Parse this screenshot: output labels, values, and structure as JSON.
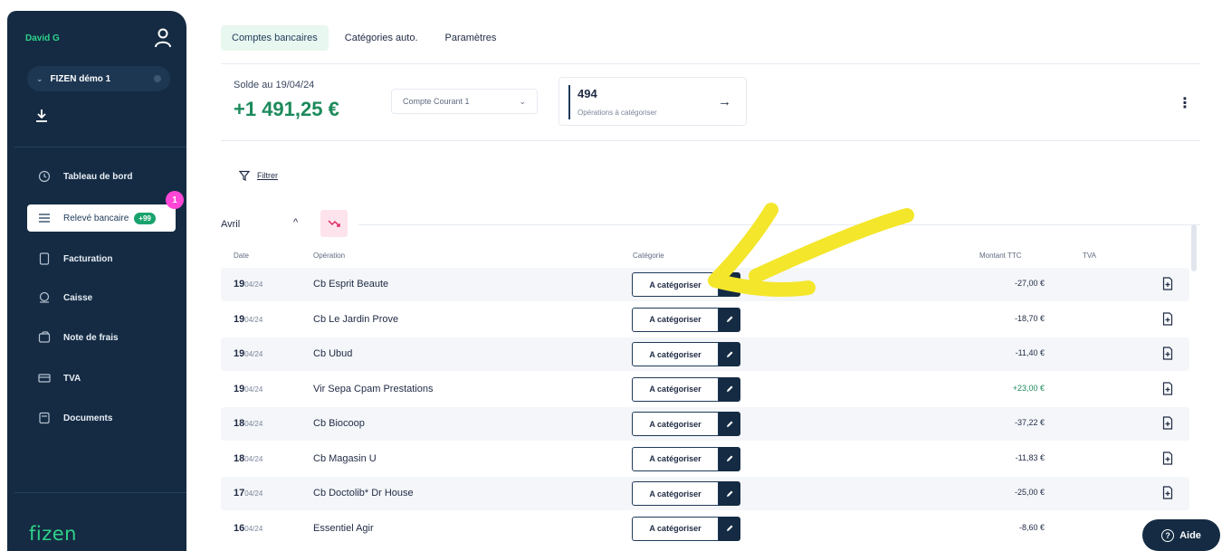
{
  "sidebar": {
    "user_name": "David G",
    "company": "FIZEN démo 1",
    "notification_count": "1",
    "items": [
      {
        "label": "Tableau de bord",
        "icon": "clock-icon"
      },
      {
        "label": "Relevé bancaire",
        "icon": "list-icon",
        "badge": "+99",
        "active": true
      },
      {
        "label": "Facturation",
        "icon": "document-icon"
      },
      {
        "label": "Caisse",
        "icon": "cash-icon"
      },
      {
        "label": "Note de frais",
        "icon": "wallet-icon"
      },
      {
        "label": "TVA",
        "icon": "card-icon"
      },
      {
        "label": "Documents",
        "icon": "folder-icon"
      }
    ],
    "logo": "fizen"
  },
  "header": {
    "tabs": [
      {
        "label": "Comptes bancaires",
        "active": true
      },
      {
        "label": "Catégories auto."
      },
      {
        "label": "Paramètres"
      }
    ]
  },
  "summary": {
    "solde_label": "Solde au 19/04/24",
    "solde_value": "+1 491,25 €",
    "account": "Compte Courant 1",
    "ops_count": "494",
    "ops_label": "Opérations à catégoriser"
  },
  "filter": {
    "label": "Filtrer"
  },
  "month": {
    "label": "Avril"
  },
  "table": {
    "headers": {
      "date": "Date",
      "operation": "Opération",
      "category": "Catégorie",
      "amount": "Montant TTC",
      "tva": "TVA"
    },
    "rows": [
      {
        "day": "19",
        "month": "04/24",
        "operation": "Cb Esprit Beaute",
        "category": "A catégoriser",
        "amount": "-27,00 €",
        "positive": false
      },
      {
        "day": "19",
        "month": "04/24",
        "operation": "Cb Le Jardin Prove",
        "category": "A catégoriser",
        "amount": "-18,70 €",
        "positive": false
      },
      {
        "day": "19",
        "month": "04/24",
        "operation": "Cb Ubud",
        "category": "A catégoriser",
        "amount": "-11,40 €",
        "positive": false
      },
      {
        "day": "19",
        "month": "04/24",
        "operation": "Vir Sepa Cpam Prestations",
        "category": "A catégoriser",
        "amount": "+23,00 €",
        "positive": true
      },
      {
        "day": "18",
        "month": "04/24",
        "operation": "Cb Biocoop",
        "category": "A catégoriser",
        "amount": "-37,22 €",
        "positive": false
      },
      {
        "day": "18",
        "month": "04/24",
        "operation": "Cb Magasin U",
        "category": "A catégoriser",
        "amount": "-11,83 €",
        "positive": false
      },
      {
        "day": "17",
        "month": "04/24",
        "operation": "Cb Doctolib* Dr House",
        "category": "A catégoriser",
        "amount": "-25,00 €",
        "positive": false
      },
      {
        "day": "16",
        "month": "04/24",
        "operation": "Essentiel Agir",
        "category": "A catégoriser",
        "amount": "-8,60 €",
        "positive": false
      }
    ]
  },
  "help": {
    "label": "Aide"
  },
  "colors": {
    "sidebar": "#142b43",
    "accent_green": "#2fd28a",
    "positive": "#1d8a5b",
    "annotation": "#f4e62a"
  }
}
